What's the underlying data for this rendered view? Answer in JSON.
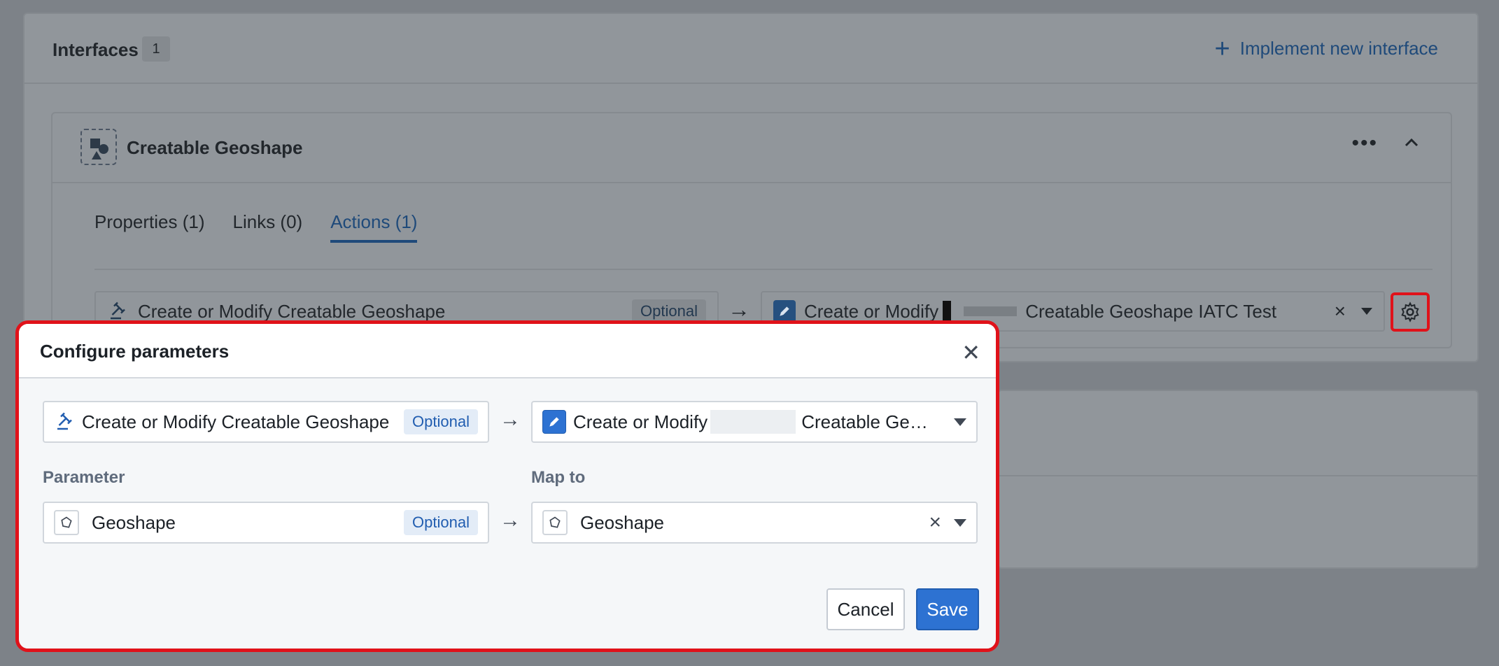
{
  "background": {
    "interfaces_title": "Interfaces",
    "interfaces_count": "1",
    "implement_label": "Implement new interface",
    "interface_name": "Creatable Geoshape",
    "tabs": [
      {
        "label": "Properties (1)"
      },
      {
        "label": "Links (0)"
      },
      {
        "label": "Actions (1)"
      }
    ],
    "action_row": {
      "left_label": "Create or Modify Creatable Geoshape",
      "left_badge": "Optional",
      "right_prefix": "Create or Modify",
      "right_suffix": "Creatable Geoshape IATC Test"
    }
  },
  "modal": {
    "title": "Configure parameters",
    "action_left_label": "Create or Modify Creatable Geoshape",
    "action_left_badge": "Optional",
    "action_right_prefix": "Create or Modify",
    "action_right_suffix": "Creatable Ge…",
    "parameter_label": "Parameter",
    "map_to_label": "Map to",
    "param_value": "Geoshape",
    "param_badge": "Optional",
    "map_value": "Geoshape",
    "cancel_label": "Cancel",
    "save_label": "Save"
  },
  "colors": {
    "accent": "#2d72d2",
    "highlight": "#e0121a"
  }
}
